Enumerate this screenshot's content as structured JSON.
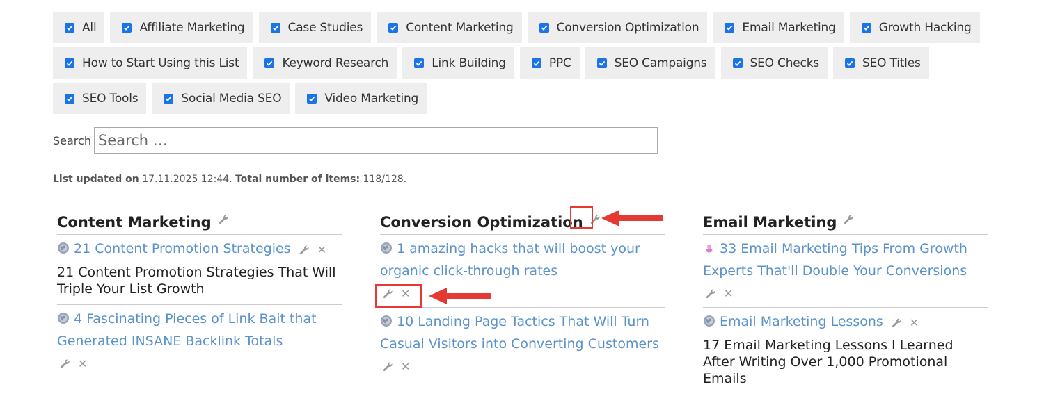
{
  "filters": {
    "rows": [
      [
        {
          "label": "All",
          "checked": true
        },
        {
          "label": "Affiliate Marketing",
          "checked": true
        },
        {
          "label": "Case Studies",
          "checked": true
        },
        {
          "label": "Content Marketing",
          "checked": true
        },
        {
          "label": "Conversion Optimization",
          "checked": true
        },
        {
          "label": "Email Marketing",
          "checked": true
        },
        {
          "label": "Growth Hacking",
          "checked": true
        }
      ],
      [
        {
          "label": "How to Start Using this List",
          "checked": true
        },
        {
          "label": "Keyword Research",
          "checked": true
        },
        {
          "label": "Link Building",
          "checked": true
        },
        {
          "label": "PPC",
          "checked": true
        },
        {
          "label": "SEO Campaigns",
          "checked": true
        },
        {
          "label": "SEO Checks",
          "checked": true
        },
        {
          "label": "SEO Titles",
          "checked": true
        }
      ],
      [
        {
          "label": "SEO Tools",
          "checked": true
        },
        {
          "label": "Social Media SEO",
          "checked": true
        },
        {
          "label": "Video Marketing",
          "checked": true
        }
      ]
    ]
  },
  "search": {
    "label": "Search",
    "placeholder": "Search …"
  },
  "status": {
    "updated_prefix": "List updated on",
    "updated_date": "17.11.2025 12:44.",
    "total_prefix": "Total number of items:",
    "total_value": "118/128."
  },
  "columns": [
    {
      "title": "Content Marketing",
      "items": [
        {
          "link": "21 Content Promotion Strategies",
          "icon": "globe-icon",
          "desc": "21 Content Promotion Strategies That Will Triple Your List Growth",
          "inline_actions": true
        },
        {
          "link": "4 Fascinating Pieces of Link Bait that Generated INSANE Backlink Totals",
          "icon": "globe-icon",
          "desc": "",
          "inline_actions": false
        }
      ]
    },
    {
      "title": "Conversion Optimization",
      "items": [
        {
          "link": "1 amazing hacks that will boost your organic click-through rates",
          "icon": "globe-icon",
          "desc": "",
          "inline_actions": false
        },
        {
          "link": "10 Landing Page Tactics That Will Turn Casual Visitors into Converting Customers",
          "icon": "globe-icon",
          "desc": "",
          "inline_actions": false
        }
      ]
    },
    {
      "title": "Email Marketing",
      "items": [
        {
          "link": "33 Email Marketing Tips From Growth Experts That'll Double Your Conversions",
          "icon": "favicon-icon",
          "desc": "",
          "inline_actions": false
        },
        {
          "link": "Email Marketing Lessons",
          "icon": "globe-icon",
          "desc": "17 Email Marketing Lessons I Learned After Writing Over 1,000 Promotional Emails",
          "inline_actions": true
        }
      ]
    }
  ],
  "colors": {
    "link": "#5b93c9",
    "chip_bg": "#eeeeee",
    "checkbox": "#1a73e8",
    "highlight": "#e53935"
  }
}
